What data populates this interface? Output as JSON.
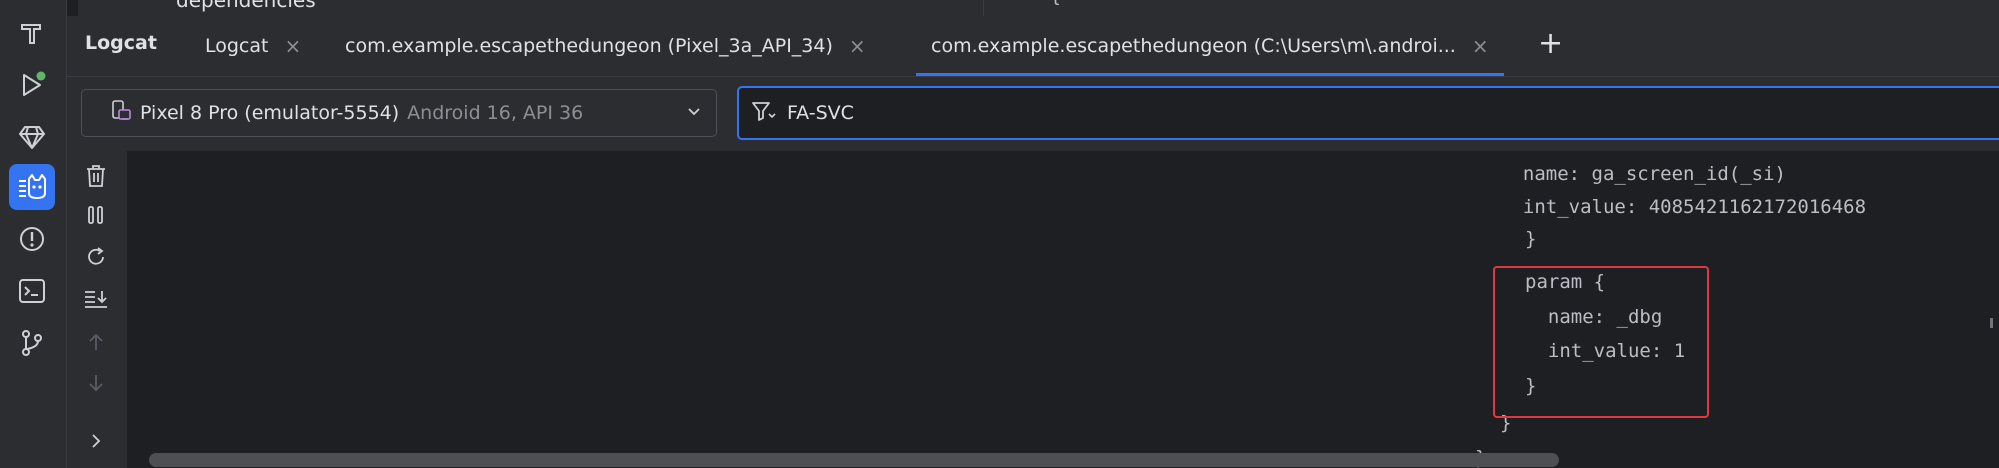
{
  "top_remnant": {
    "text": "dependencies",
    "brace": "{"
  },
  "tool_strip": {
    "items": [
      {
        "name": "build-icon"
      },
      {
        "name": "run-icon"
      },
      {
        "name": "gem-icon"
      },
      {
        "name": "logcat-icon",
        "active": true
      },
      {
        "name": "problems-icon"
      },
      {
        "name": "terminal-icon"
      },
      {
        "name": "git-icon"
      }
    ]
  },
  "tabs_bar": {
    "panel_title": "Logcat",
    "tabs": [
      {
        "label": "Logcat",
        "close": "×"
      },
      {
        "label": "com.example.escapethedungeon (Pixel_3a_API_34)",
        "close": "×"
      },
      {
        "label": "com.example.escapethedungeon (C:\\Users\\m\\.androi...",
        "close": "×",
        "active": true
      }
    ],
    "add_label": "+"
  },
  "toolbar": {
    "device": {
      "name": "Pixel 8 Pro (emulator-5554)",
      "details": "Android 16, API 36"
    },
    "filter": {
      "value": "FA-SVC"
    }
  },
  "log_tools": [
    "trash-icon",
    "pause-icon",
    "restart-icon",
    "scroll-to-end-icon",
    "up-arrow-icon",
    "down-arrow-icon",
    "expand-icon"
  ],
  "log": {
    "lines": [
      "  name: ga_screen_id(_si)",
      "  int_value: 4085421162172016468",
      "}",
      "param {",
      "  name: _dbg",
      "  int_value: 1",
      "}",
      "}",
      "}"
    ]
  },
  "colors": {
    "accent": "#3574f0",
    "highlight": "#e0383e",
    "run_badge": "#5fb865"
  }
}
